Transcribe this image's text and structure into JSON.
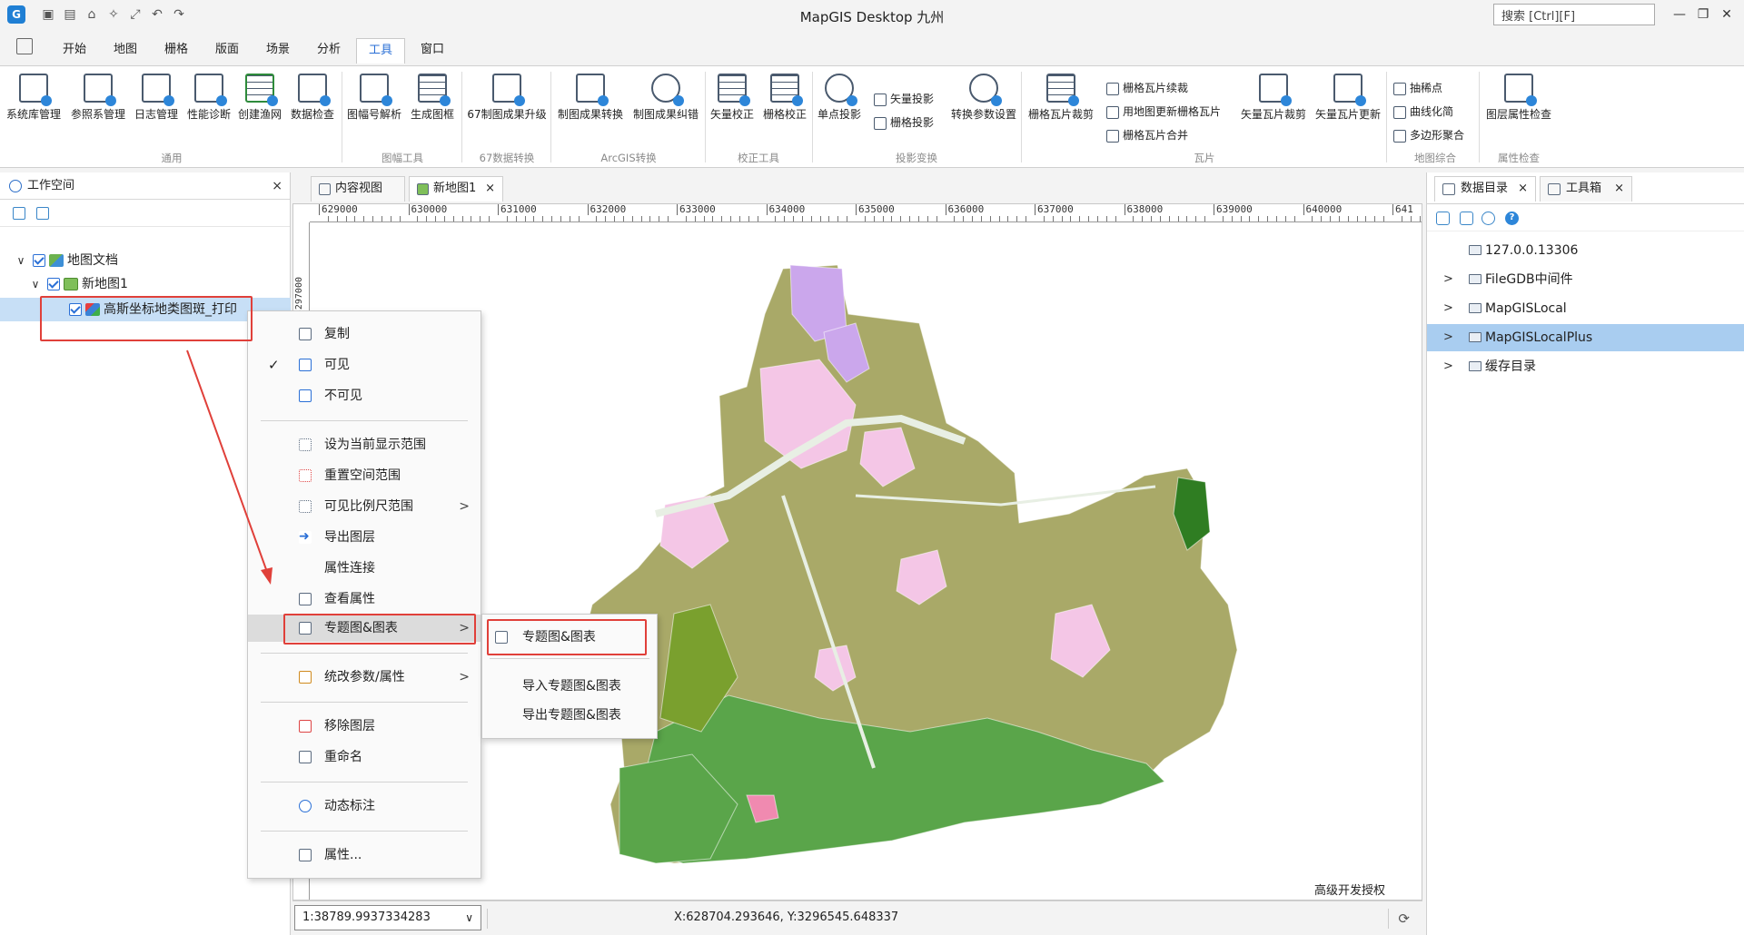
{
  "window": {
    "title": "MapGIS Desktop 九州",
    "search_placeholder": "搜索 [Ctrl][F]",
    "icon": "mapgis-app-icon"
  },
  "quick_access": [
    "save-icon",
    "save-all-icon",
    "home-icon",
    "magic-wand-icon",
    "fullscreen-icon",
    "undo-icon",
    "redo-icon"
  ],
  "ribbon_tabs": [
    "开始",
    "地图",
    "栅格",
    "版面",
    "场景",
    "分析",
    "工具",
    "窗口"
  ],
  "active_tab": "工具",
  "ribbon": {
    "groups": [
      {
        "label": "通用",
        "buttons": [
          "系统库管理",
          "参照系管理",
          "日志管理",
          "性能诊断",
          "创建渔网",
          "数据检查"
        ]
      },
      {
        "label": "图幅工具",
        "buttons": [
          "图幅号解析",
          "生成图框"
        ]
      },
      {
        "label": "67数据转换",
        "buttons": [
          "67制图成果升级"
        ]
      },
      {
        "label": "ArcGIS转换",
        "buttons": [
          "制图成果转换",
          "制图成果纠错"
        ]
      },
      {
        "label": "校正工具",
        "buttons": [
          "矢量校正",
          "栅格校正"
        ]
      },
      {
        "label": "投影变换",
        "buttons": [
          "单点投影",
          "转换参数设置"
        ],
        "small": [
          "矢量投影",
          "栅格投影"
        ]
      },
      {
        "label": "瓦片",
        "buttons": [
          "栅格瓦片裁剪",
          "矢量瓦片裁剪",
          "矢量瓦片更新"
        ],
        "small": [
          "栅格瓦片续裁",
          "用地图更新栅格瓦片",
          "栅格瓦片合并"
        ]
      },
      {
        "label": "地图综合",
        "small": [
          "抽稀点",
          "曲线化简",
          "多边形聚合"
        ]
      },
      {
        "label": "属性检查",
        "buttons": [
          "图层属性检查"
        ]
      }
    ]
  },
  "workspace": {
    "title": "工作空间",
    "tree": {
      "root": "地图文档",
      "map": "新地图1",
      "layer": "高斯坐标地类图斑_打印"
    }
  },
  "doc_tabs": [
    "内容视图",
    "新地图1"
  ],
  "active_doc_tab": "新地图1",
  "map": {
    "ruler_x": [
      "629000",
      "630000",
      "631000",
      "632000",
      "633000",
      "634000",
      "635000",
      "636000",
      "637000",
      "638000",
      "639000",
      "640000",
      "641"
    ],
    "ruler_y": "3297000",
    "license": "高级开发授权",
    "scale": "1:38789.9937334283",
    "coords": "X:628704.293646, Y:3296545.648337",
    "colors": {
      "farmland": "#a9a968",
      "forest": "#5aa54a",
      "darkgreen": "#2f7d22",
      "pink": "#f4c6e6",
      "lavender": "#cba7ec",
      "road": "#e8efe4"
    }
  },
  "context_menu": {
    "items": [
      {
        "label": "复制",
        "icon": "copy-icon"
      },
      {
        "label": "可见",
        "icon": "checkbox-checked-icon",
        "checked": true
      },
      {
        "label": "不可见",
        "icon": "checkbox-empty-icon"
      },
      {
        "label": "设为当前显示范围",
        "icon": "extent-icon"
      },
      {
        "label": "重置空间范围",
        "icon": "reset-extent-icon"
      },
      {
        "label": "可见比例尺范围",
        "icon": "scale-range-icon",
        "submenu": true
      },
      {
        "label": "导出图层",
        "icon": "export-arrow-icon"
      },
      {
        "label": "属性连接",
        "icon": ""
      },
      {
        "label": "查看属性",
        "icon": "view-attribute-icon"
      },
      {
        "label": "专题图&图表",
        "icon": "thematic-map-icon",
        "submenu": true
      },
      {
        "label": "统改参数/属性",
        "icon": "edit-params-icon",
        "submenu": true
      },
      {
        "label": "移除图层",
        "icon": "remove-layer-icon"
      },
      {
        "label": "重命名",
        "icon": "rename-icon"
      },
      {
        "label": "动态标注",
        "icon": "dynamic-label-icon"
      },
      {
        "label": "属性...",
        "icon": "properties-icon"
      }
    ],
    "submenu": [
      "专题图&图表",
      "导入专题图&图表",
      "导出专题图&图表"
    ]
  },
  "right_panel": {
    "tabs": [
      "数据目录",
      "工具箱"
    ],
    "items": [
      "127.0.0.13306",
      "FileGDB中间件",
      "MapGISLocal",
      "MapGISLocalPlus",
      "缓存目录"
    ],
    "selected": "MapGISLocalPlus"
  }
}
